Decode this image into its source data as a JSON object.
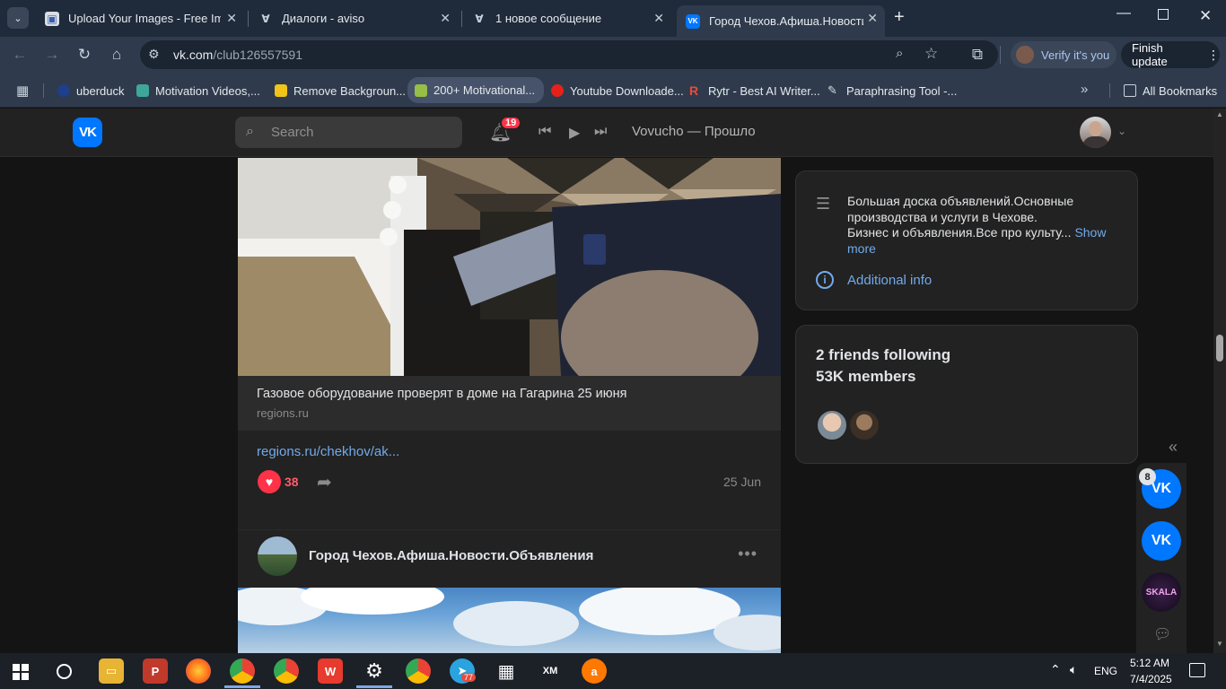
{
  "browser": {
    "tabs": [
      {
        "title": "Upload Your Images - Free Imag",
        "active": false
      },
      {
        "title": "Диалоги - aviso",
        "active": false
      },
      {
        "title": "1 новое сообщение",
        "active": false
      },
      {
        "title": "Город Чехов.Афиша.Новости.О",
        "active": true
      }
    ],
    "url_host": "vk.com",
    "url_path": "/club126557591",
    "verify_label": "Verify it's you",
    "finish_label": "Finish update",
    "bookmarks": [
      {
        "label": "uberduck",
        "color": "#1f3f8a"
      },
      {
        "label": "Motivation Videos,...",
        "color": "#3fa79a"
      },
      {
        "label": "Remove Backgroun...",
        "color": "#f0c419"
      },
      {
        "label": "200+ Motivational...",
        "color": "#95bf47"
      },
      {
        "label": "Youtube Downloade...",
        "color": "#e62117"
      },
      {
        "label": "Rytr - Best AI Writer...",
        "color": "#e94b3c"
      },
      {
        "label": "Paraphrasing Tool -...",
        "color": "#dddddd"
      }
    ],
    "all_bookmarks": "All Bookmarks"
  },
  "vk": {
    "logo": "VK",
    "search_placeholder": "Search",
    "notifications_count": "19",
    "now_playing": "Vovucho — Прошло"
  },
  "post": {
    "link_title": "Газовое оборудование проверят в доме на Гагарина 25 июня",
    "link_domain": "regions.ru",
    "link_url": "regions.ru/chekhov/ak...",
    "likes": "38",
    "date": "25 Jun"
  },
  "post2": {
    "author": "Город Чехов.Афиша.Новости.Объявления",
    "more": "•••"
  },
  "sidebar": {
    "description_line1": "Большая доска объявлений.Основные производства и услуги в Чехове.",
    "description_line2": "Бизнес и объявления.Все про культу...",
    "show_more": "Show more",
    "additional_info": "Additional info",
    "friends_following": "2 friends following",
    "members": "53K members"
  },
  "chats": {
    "badge": "8",
    "skala_label": "SKALA"
  },
  "taskbar": {
    "telegram_badge": "77",
    "language": "ENG",
    "time": "5:12 AM",
    "date": "7/4/2025"
  },
  "colors": {
    "vk_blue": "#0077ff",
    "link_blue": "#71aaeb",
    "like_red": "#ff3347"
  }
}
